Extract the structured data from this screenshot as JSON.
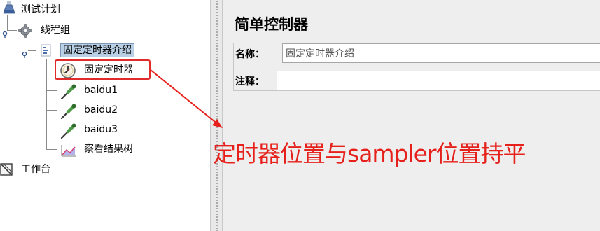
{
  "tree": {
    "test_plan": "测试计划",
    "thread_group": "线程组",
    "controller": "固定定时器介绍",
    "timer": "固定定时器",
    "sampler1": "baidu1",
    "sampler2": "baidu2",
    "sampler3": "baidu3",
    "listener": "察看结果树",
    "workbench": "工作台"
  },
  "panel": {
    "title": "简单控制器",
    "name_label": "名称：",
    "name_value": "固定定时器介绍",
    "comment_label": "注释：",
    "comment_value": ""
  },
  "annotation": {
    "text": "定时器位置与sampler位置持平",
    "color": "#e6211b"
  },
  "icons": {
    "test_plan": "flask-icon",
    "thread_group": "gear-icon",
    "controller": "controller-icon",
    "timer": "stopwatch-icon",
    "sampler": "pipette-icon",
    "listener": "chart-icon",
    "workbench": "workbench-icon"
  }
}
